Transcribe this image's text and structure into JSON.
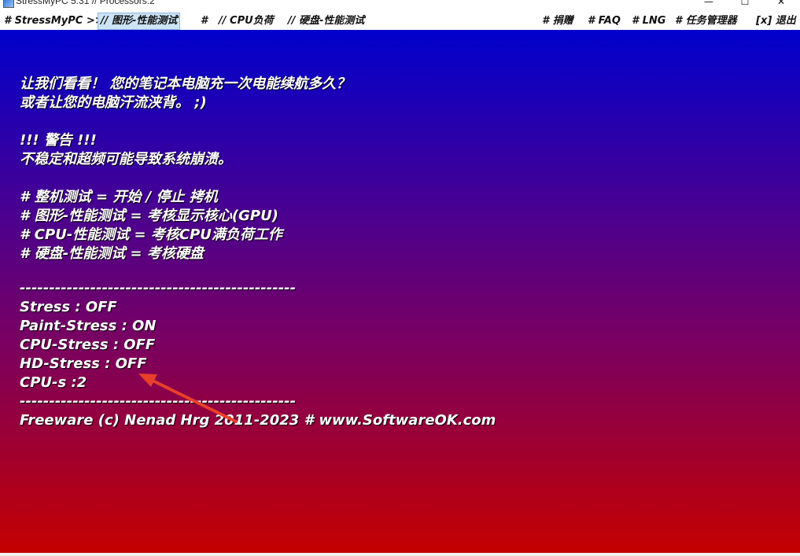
{
  "window": {
    "title": "StressMyPC 5.31 // Processors:2",
    "minimize_glyph": "—",
    "maximize_glyph": "☐",
    "close_glyph": "✕"
  },
  "menu": {
    "items": [
      {
        "label": "# StressMyPC >>"
      },
      {
        "label": "// 图形-性能测试"
      },
      {
        "label": "#"
      },
      {
        "label": "// CPU负荷"
      },
      {
        "label": "// 硬盘-性能测试"
      },
      {
        "label": "# 捐赠"
      },
      {
        "label": "# FAQ"
      },
      {
        "label": "# LNG"
      },
      {
        "label": "# 任务管理器"
      },
      {
        "label": "[x] 退出"
      }
    ]
  },
  "content": {
    "intro_line1": "让我们看看！ 您的笔记本电脑充一次电能续航多久？",
    "intro_line2": "或者让您的电脑汗流浃背。 ;)",
    "warning_title": "!!! 警告 !!!",
    "warning_text": "不稳定和超频可能导致系统崩溃。",
    "help": [
      "# 整机测试 = 开始 / 停止 拷机",
      "# 图形-性能测试 = 考核显示核心(GPU)",
      "# CPU-性能测试 = 考核CPU满负荷工作",
      "# 硬盘-性能测试 = 考核硬盘"
    ],
    "separator": "-----------------------------------------------",
    "status": [
      "Stress : OFF",
      "Paint-Stress : ON",
      "CPU-Stress : OFF",
      "HD-Stress : OFF",
      "CPU-s :2"
    ],
    "footer": "Freeware (c) Nenad Hrg 2011-2023 # www.SoftwareOK.com"
  },
  "colors": {
    "gradient_top": "#0000cc",
    "gradient_bottom": "#c40000",
    "arrow": "#e8402a"
  }
}
